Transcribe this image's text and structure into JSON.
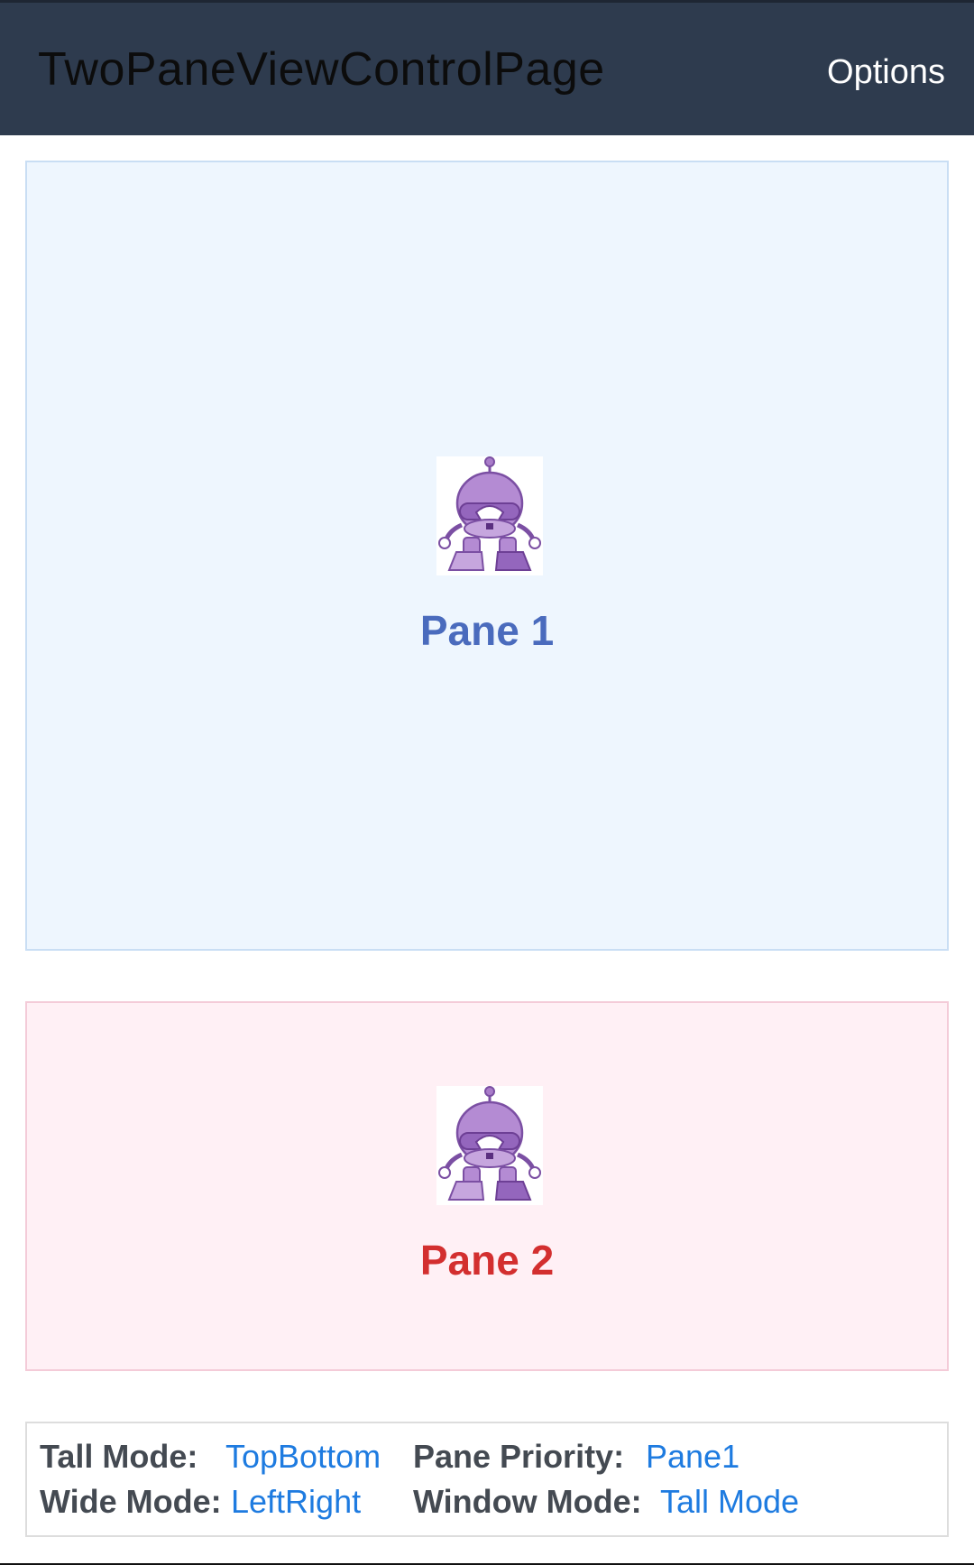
{
  "toolbar": {
    "title": "TwoPaneViewControlPage",
    "options_label": "Options"
  },
  "pane1": {
    "label": "Pane 1",
    "icon": "robot-mascot-icon",
    "background": "#eef6fe",
    "label_color": "#4a6bbd"
  },
  "pane2": {
    "label": "Pane 2",
    "icon": "robot-mascot-icon",
    "background": "#fff0f5",
    "label_color": "#d32f2f"
  },
  "info": {
    "tall_mode_label": "Tall Mode:",
    "tall_mode_value": "TopBottom",
    "wide_mode_label": "Wide Mode:",
    "wide_mode_value": "LeftRight",
    "pane_priority_label": "Pane Priority:",
    "pane_priority_value": "Pane1",
    "window_mode_label": "Window Mode:",
    "window_mode_value": "Tall Mode"
  },
  "colors": {
    "toolbar": "#2e3b4e",
    "link": "#1e7be0"
  }
}
